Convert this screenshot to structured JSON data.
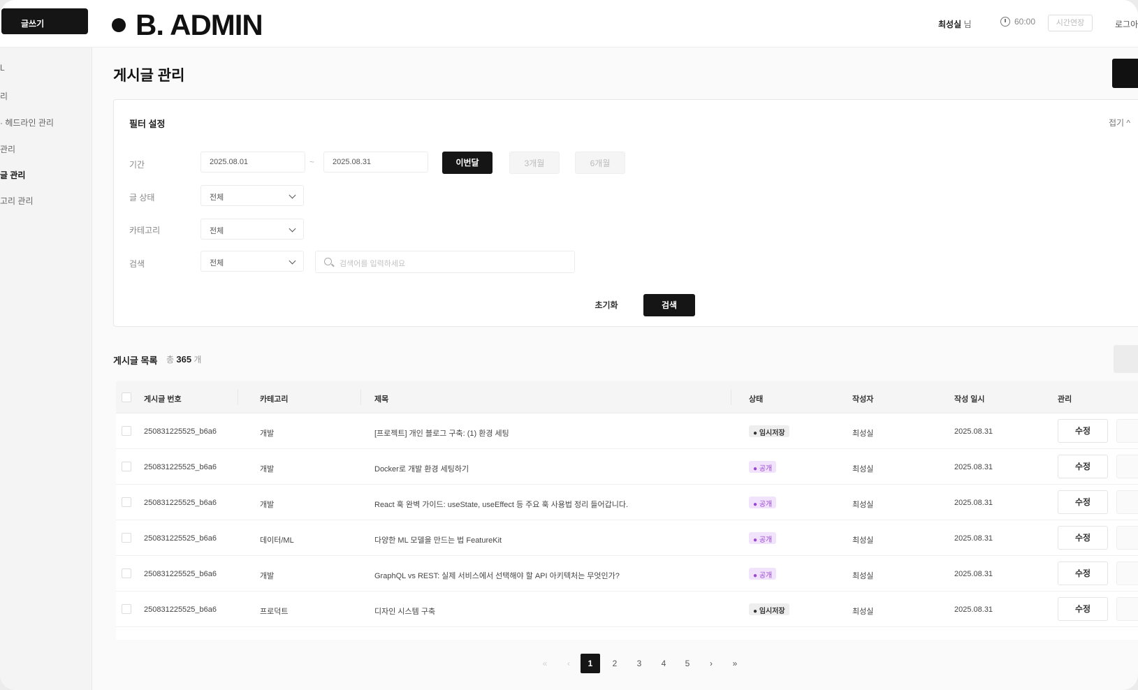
{
  "header": {
    "write_button": "글쓰기",
    "logo_text": "B. ADMIN",
    "user_name": "최성실",
    "user_suffix": " 님",
    "timer": "60:00",
    "extend_button": "시간연장",
    "logout": "로그아웃"
  },
  "sidebar": {
    "items": [
      {
        "label": "L"
      },
      {
        "label": "리"
      },
      {
        "label": "· 헤드라인 관리"
      },
      {
        "label": "관리"
      },
      {
        "label": "글 관리",
        "active": true
      },
      {
        "label": "고리 관리"
      }
    ]
  },
  "page": {
    "title": "게시글 관리"
  },
  "filter": {
    "title": "필터 설정",
    "collapse_label": "접기 ^",
    "period_label": "기간",
    "date_from": "2025.08.01",
    "date_to": "2025.08.31",
    "tilde": "~",
    "quick_buttons": [
      "이번달",
      "3개월",
      "6개월"
    ],
    "status_label": "글 상태",
    "status_value": "전체",
    "category_label": "카테고리",
    "category_value": "전체",
    "search_label": "검색",
    "search_type_value": "전체",
    "search_placeholder": "검색어를 입력하세요",
    "reset_button": "초기화",
    "search_button": "검색"
  },
  "list": {
    "title": "게시글 목록",
    "count_prefix": "총 ",
    "count": "365",
    "count_suffix": " 개",
    "columns": [
      "게시글 번호",
      "카테고리",
      "제목",
      "상태",
      "작성자",
      "작성 일시",
      "관리"
    ],
    "rows": [
      {
        "id": "250831225525_b6a6",
        "category": "개발",
        "title": "[프로젝트] 개인 블로그 구축: (1) 환경 세팅",
        "status": "● 임시저장",
        "status_type": "temp",
        "author": "최성실",
        "date": "2025.08.31",
        "edit": "수정"
      },
      {
        "id": "250831225525_b6a6",
        "category": "개발",
        "title": "Docker로 개발 환경 세팅하기",
        "status": "● 공개",
        "status_type": "pub",
        "author": "최성실",
        "date": "2025.08.31",
        "edit": "수정"
      },
      {
        "id": "250831225525_b6a6",
        "category": "개발",
        "title": "React 훅 완벽 가이드: useState, useEffect 등 주요 훅 사용법 정리 들어갑니다.",
        "status": "● 공개",
        "status_type": "pub",
        "author": "최성실",
        "date": "2025.08.31",
        "edit": "수정"
      },
      {
        "id": "250831225525_b6a6",
        "category": "데이터/ML",
        "title": "다양한 ML 모델을 만드는 법 FeatureKit",
        "status": "● 공개",
        "status_type": "pub",
        "author": "최성실",
        "date": "2025.08.31",
        "edit": "수정"
      },
      {
        "id": "250831225525_b6a6",
        "category": "개발",
        "title": "GraphQL vs REST: 실제 서비스에서 선택해야 할 API 아키텍처는 무엇인가?",
        "status": "● 공개",
        "status_type": "pub",
        "author": "최성실",
        "date": "2025.08.31",
        "edit": "수정"
      },
      {
        "id": "250831225525_b6a6",
        "category": "프로덕트",
        "title": "디자인 시스템 구축",
        "status": "● 임시저장",
        "status_type": "temp",
        "author": "최성실",
        "date": "2025.08.31",
        "edit": "수정"
      }
    ]
  },
  "pagination": {
    "first": "«",
    "prev": "‹",
    "pages": [
      "1",
      "2",
      "3",
      "4",
      "5"
    ],
    "current": "1",
    "next": "›",
    "last": "»"
  }
}
